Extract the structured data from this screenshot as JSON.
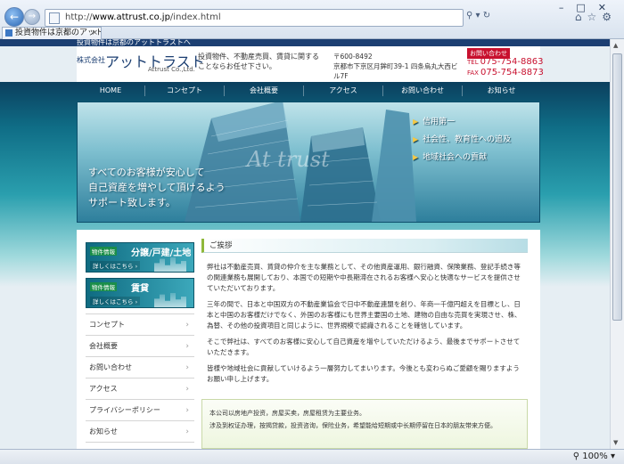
{
  "browser": {
    "url_prefix": "http://",
    "url_host": "www.attrust.co.jp",
    "url_path": "/index.html",
    "tab_title": "投資物件は京都のアット...",
    "tab_close": "×",
    "zoom": "100%"
  },
  "site": {
    "tagline": "投資物件は京都のアットトラストへ",
    "logo_prefix": "株式会社",
    "logo_name": "アットトラスト",
    "logo_en": "Attrust Co.,Ltd.",
    "header_desc": "投資物件、不動産売買、賃貸に関することならお任せ下さい。",
    "postal": "〒600-8492",
    "address": "京都市下京区月鉾町39-1 四条烏丸大西ビル7F",
    "inquiry_badge": "お問い合わせ",
    "tel_label": "TEL",
    "tel": "075-754-8863",
    "fax_label": "FAX",
    "fax": "075-754-8873"
  },
  "nav": {
    "items": [
      "HOME",
      "コンセプト",
      "会社概要",
      "アクセス",
      "お問い合わせ",
      "お知らせ"
    ]
  },
  "hero": {
    "watermark": "At trust",
    "copy_lines": [
      "すべてのお客様が安心して",
      "自己資産を増やして頂けるよう",
      "サポート致します。"
    ],
    "features": [
      "信用第一",
      "社会性、教育性への追及",
      "地域社会への貢献"
    ]
  },
  "sidebar": {
    "banners": [
      {
        "tag": "物件情報",
        "title": "分譲/戸建/土地",
        "more": "詳しくはこちら ›"
      },
      {
        "tag": "物件情報",
        "title": "賃貸",
        "more": "詳しくはこちら ›"
      }
    ],
    "menu": [
      "コンセプト",
      "会社概要",
      "お問い合わせ",
      "アクセス",
      "プライバシーポリシー",
      "お知らせ"
    ]
  },
  "main": {
    "section_title": "ご挨拶",
    "paragraphs": [
      "弊社は不動産売買、賃貸の仲介を主な業務として、その他資産運用、銀行融資、保険業務、登記手続き等の関連業務も展開しており、本国での短期や中長期滞在されるお客様へ安心と快適なサービスを提供させていただいております。",
      "三年の間で、日本と中国双方の不動産業協会で日中不動産連盟を創り、年商一千億円超えを目標とし、日本と中国のお客様だけでなく、外国のお客様にも世界主要国の土地、建物の自由な売買を実現させ、株、為替、その他の投資項目と同じように、世界規模で認識されることを確信しています。",
      "そこで弊社は、すべてのお客様に安心して自己資産を増やしていただけるよう、最後までサポートさせていただきます。",
      "皆様や地域社会に貢献していけるよう一層努力してまいります。今後とも変わらぬご愛顧を賜りますようお願い申し上げます。"
    ],
    "cn_lines": [
      "本公司以房地产投资，房屋买卖，房屋租赁为主要业务。",
      "涉及到权证办理，按揭贷款，投资咨询，保险业务，希望能给短期或中长期停留在日本的朋友带来方便。"
    ]
  }
}
